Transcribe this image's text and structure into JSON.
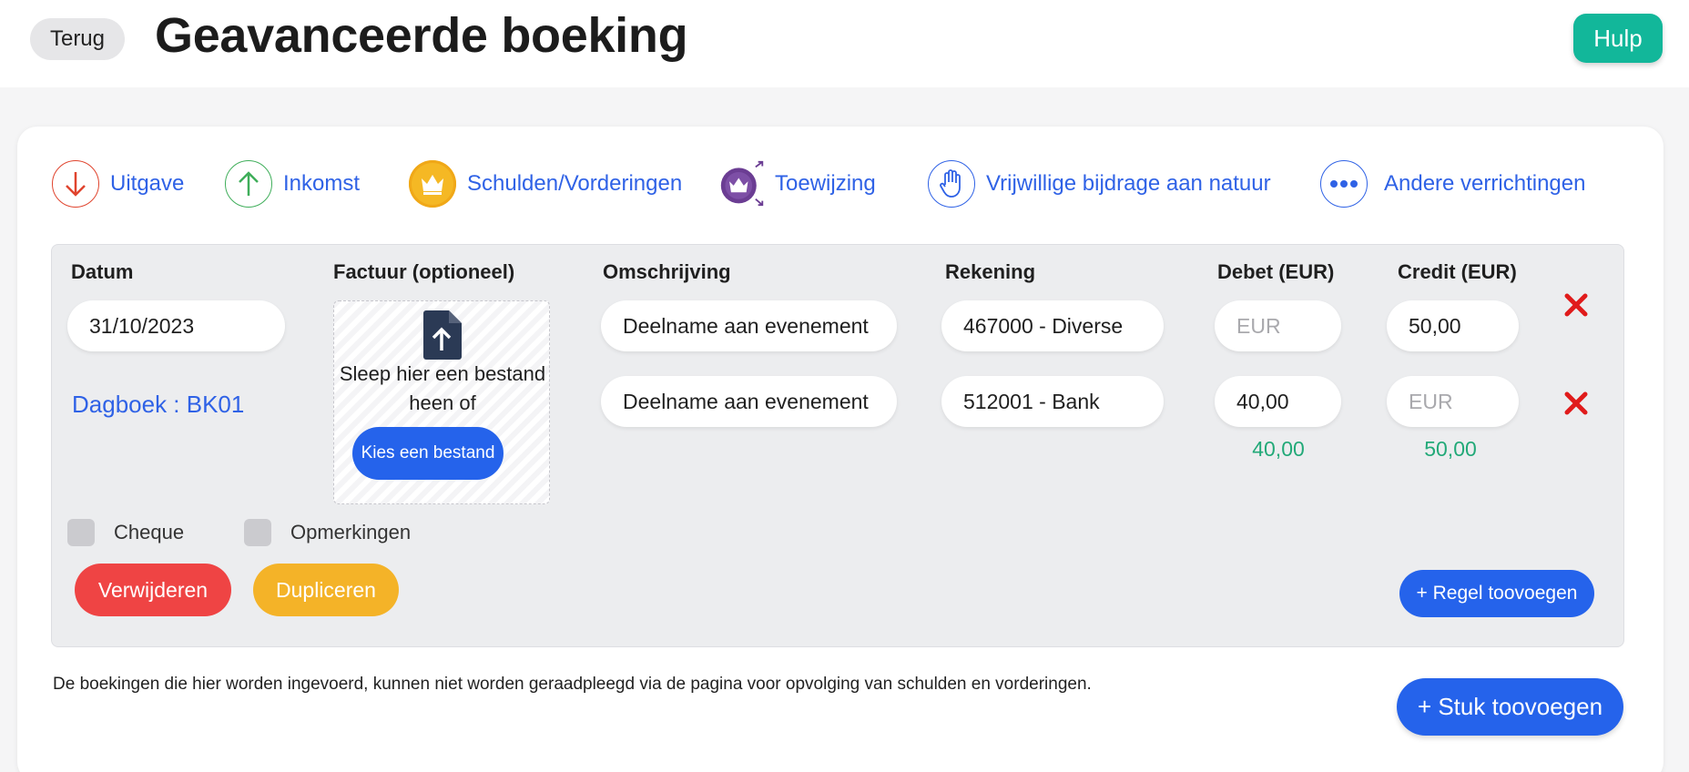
{
  "header": {
    "back_label": "Terug",
    "title": "Geavanceerde boeking",
    "help_label": "Hulp"
  },
  "types": [
    {
      "label": "Uitgave",
      "icon": "arrow-down-icon",
      "color": "#e0442e"
    },
    {
      "label": "Inkomst",
      "icon": "arrow-up-icon",
      "color": "#3fae5a"
    },
    {
      "label": "Schulden/Vorderingen",
      "icon": "crown-icon",
      "color": "#f5b824"
    },
    {
      "label": "Toewijzing",
      "icon": "crown-transfer-icon",
      "color": "#6b3d93"
    },
    {
      "label": "Vrijwillige bijdrage aan natuur",
      "icon": "hand-icon",
      "color": "#2f62e6"
    },
    {
      "label": "Andere verrichtingen",
      "icon": "more-dots-icon",
      "color": "#2f62e6"
    }
  ],
  "columns": {
    "date": "Datum",
    "invoice": "Factuur (optioneel)",
    "description": "Omschrijving",
    "account": "Rekening",
    "debit": "Debet (EUR)",
    "credit": "Credit (EUR)"
  },
  "entry": {
    "date": "31/10/2023",
    "journal": "Dagboek : BK01"
  },
  "upload": {
    "drop_text": "Sleep hier een bestand heen of",
    "choose_label": "Kies een bestand"
  },
  "lines": [
    {
      "description": "Deelname aan evenement",
      "account": "467000 - Diverse",
      "debit": "",
      "credit": "50,00"
    },
    {
      "description": "Deelname aan evenement",
      "account": "512001 - Bank",
      "debit": "40,00",
      "credit": ""
    }
  ],
  "amount_placeholder": "EUR",
  "totals": {
    "debit": "40,00",
    "credit": "50,00"
  },
  "options": {
    "cheque": "Cheque",
    "remarks": "Opmerkingen"
  },
  "actions": {
    "delete": "Verwijderen",
    "duplicate": "Dupliceren",
    "add_line": "+ Regel toovoegen"
  },
  "footer": {
    "note": "De boekingen die hier worden ingevoerd, kunnen niet worden geraadpleegd via de pagina voor opvolging van schulden en vorderingen.",
    "add_piece": "+ Stuk toovoegen"
  },
  "colors": {
    "primary": "#2563eb",
    "help": "#12b79a",
    "danger": "#ef4444",
    "warning": "#f4b328",
    "delete_x": "#e01b1b",
    "totals": "#22a978"
  }
}
